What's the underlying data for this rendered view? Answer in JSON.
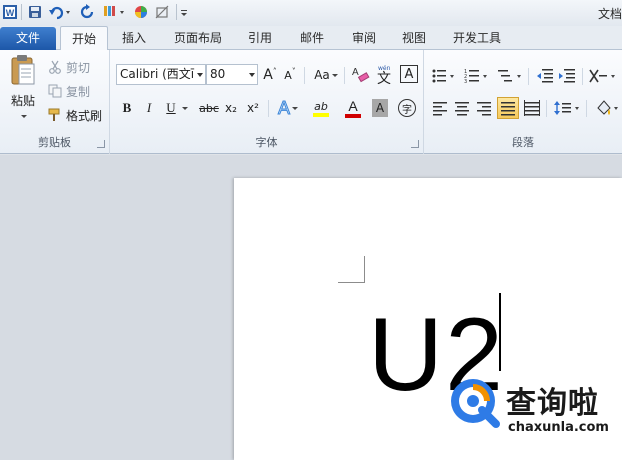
{
  "window": {
    "title": "文档"
  },
  "tabs": {
    "file": "文件",
    "items": [
      "开始",
      "插入",
      "页面布局",
      "引用",
      "邮件",
      "审阅",
      "视图",
      "开发工具"
    ],
    "active": "开始"
  },
  "clipboard": {
    "paste": "粘贴",
    "cut": "剪切",
    "copy": "复制",
    "format_painter": "格式刷",
    "label": "剪贴板"
  },
  "font": {
    "name": "Calibri (西文ī",
    "size": "80",
    "grow": "A",
    "shrink": "A",
    "change_case": "Aa",
    "clear_format": "A",
    "bold": "B",
    "italic": "I",
    "underline": "U",
    "strikethrough": "abc",
    "subscript": "x₂",
    "superscript": "x²",
    "text_effects": "A",
    "highlight": "ab",
    "font_color": "A",
    "char_shading": "A",
    "enclose": "字",
    "phonetic": "文",
    "char_border": "A",
    "label": "字体"
  },
  "paragraph": {
    "label": "段落"
  },
  "document": {
    "text": "U2"
  },
  "watermark": {
    "title": "查询啦",
    "url": "chaxunla.com"
  },
  "colors": {
    "file_tab": "#2a64b8",
    "highlight_yellow": "#ffff00",
    "font_color_red": "#d00000",
    "logo_blue": "#2e7be6",
    "logo_orange": "#f29100"
  }
}
